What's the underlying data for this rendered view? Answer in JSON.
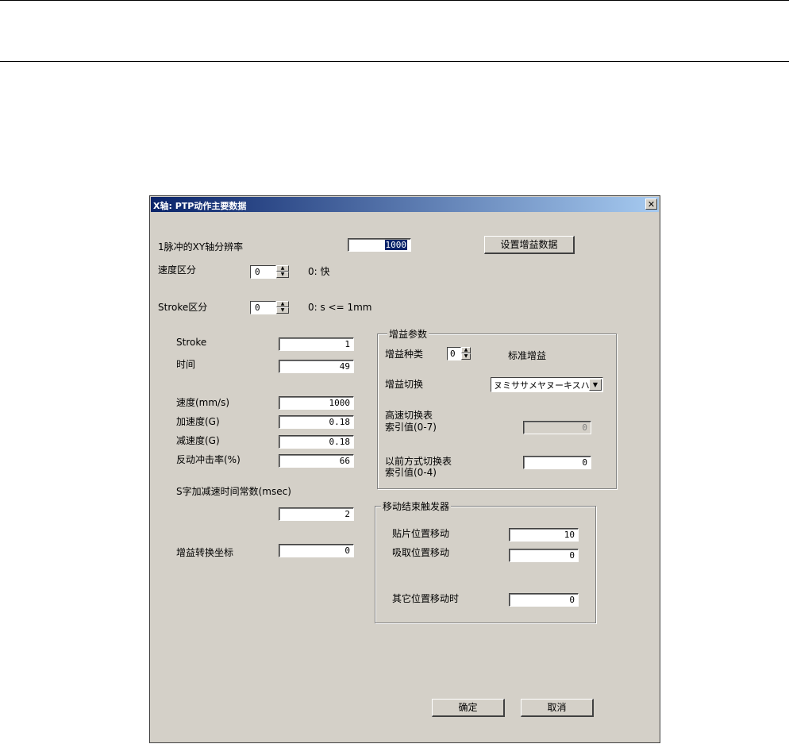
{
  "window": {
    "title": "X轴: PTP动作主要数据",
    "close_icon": "close-icon"
  },
  "top": {
    "resolution_label": "1脉冲的XY轴分辨率",
    "resolution_value": "1000",
    "gain_data_button": "设置增益数据",
    "speed_class_label": "速度区分",
    "speed_class_value": "0",
    "speed_class_desc": "0: 快",
    "stroke_class_label": "Stroke区分",
    "stroke_class_value": "0",
    "stroke_class_desc": "0: s <= 1mm"
  },
  "left": {
    "stroke_label": "Stroke",
    "stroke_value": "1",
    "time_label": "时间",
    "time_value": "49",
    "speed_label": "速度(mm/s)",
    "speed_value": "1000",
    "accel_label": "加速度(G)",
    "accel_value": "0.18",
    "decel_label": "减速度(G)",
    "decel_value": "0.18",
    "jerk_label": "反动冲击率(%)",
    "jerk_value": "66",
    "s_curve_label": "S字加减速时间常数(msec)",
    "s_curve_value": "2",
    "gain_switch_coord_label": "增益转换坐标",
    "gain_switch_coord_value": "0"
  },
  "gain_params": {
    "title": "增益参数",
    "type_label": "增益种类",
    "type_value": "0",
    "type_desc": "标准增益",
    "switch_label": "增益切换",
    "switch_value": "ヌミササメヤヌーキスハス",
    "high_speed_label_1": "高速切换表",
    "high_speed_label_2": "索引值(0-7)",
    "high_speed_value": "0",
    "legacy_label_1": "以前方式切换表",
    "legacy_label_2": "索引值(0-4)",
    "legacy_value": "0"
  },
  "move_trigger": {
    "title": "移动结束触发器",
    "mount_label": "贴片位置移动",
    "mount_value": "10",
    "pick_label": "吸取位置移动",
    "pick_value": "0",
    "other_label": "其它位置移动时",
    "other_value": "0"
  },
  "footer": {
    "ok": "确定",
    "cancel": "取消"
  }
}
